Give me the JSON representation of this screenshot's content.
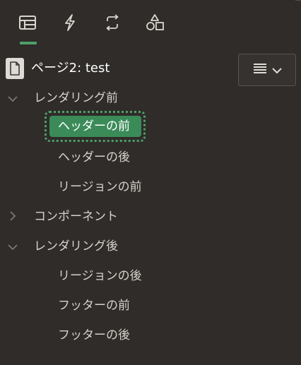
{
  "tabs": [
    {
      "icon": "layout-icon",
      "active": true
    },
    {
      "icon": "lightning-icon",
      "active": false
    },
    {
      "icon": "refresh-icon",
      "active": false
    },
    {
      "icon": "shapes-icon",
      "active": false
    }
  ],
  "page": {
    "title": "ページ2: test",
    "icon": "page-icon"
  },
  "menu_button": {
    "icons": [
      "hamburger-icon",
      "chevron-down-icon"
    ]
  },
  "tree": {
    "groups": [
      {
        "label": "レンダリング前",
        "expanded": true,
        "children": [
          "ヘッダーの前",
          "ヘッダーの後",
          "リージョンの前"
        ]
      },
      {
        "label": "コンポーネント",
        "expanded": false,
        "children": []
      },
      {
        "label": "レンダリング後",
        "expanded": true,
        "children": [
          "リージョンの後",
          "フッターの前",
          "フッターの後"
        ]
      }
    ],
    "selected": "ヘッダーの前"
  },
  "colors": {
    "background": "#2f2c29",
    "accent": "#4f9e6a",
    "selected_bg": "#3b8b59",
    "text": "#d6d2cc"
  }
}
